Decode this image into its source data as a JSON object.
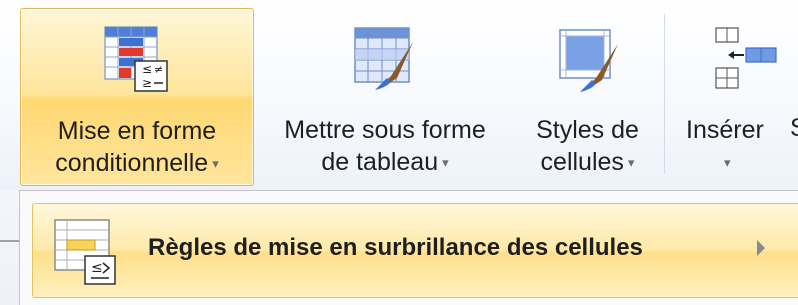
{
  "ribbon": {
    "buttons": [
      {
        "id": "conditional-formatting",
        "line1": "Mise en forme",
        "line2": "conditionnelle",
        "dropdown": "▾",
        "icon": "conditional-formatting-icon",
        "active": true
      },
      {
        "id": "format-as-table",
        "line1": "Mettre sous forme",
        "line2": "de tableau",
        "dropdown": "▾",
        "icon": "format-as-table-icon",
        "active": false
      },
      {
        "id": "cell-styles",
        "line1": "Styles de",
        "line2": "cellules",
        "dropdown": "▾",
        "icon": "cell-styles-icon",
        "active": false
      },
      {
        "id": "insert",
        "line1": "Insérer",
        "line2": "",
        "dropdown": "▾",
        "icon": "insert-cells-icon",
        "active": false
      }
    ],
    "truncated_next": "S"
  },
  "menu": {
    "items": [
      {
        "label": "Règles de mise en surbrillance des cellules",
        "icon": "highlight-cells-rules-icon",
        "submenu_arrow": "chevron-right-icon"
      }
    ]
  },
  "colors": {
    "active_highlight": "#ffe08a",
    "active_border": "#e0b95a",
    "icon_blue": "#3f6fd0",
    "icon_red": "#e03a2f"
  }
}
